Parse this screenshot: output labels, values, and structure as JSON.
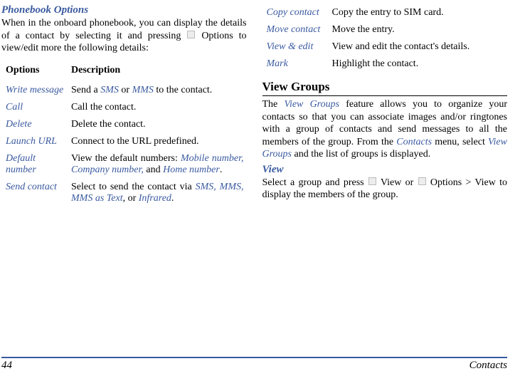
{
  "left": {
    "heading": "Phonebook Options",
    "intro_a": "When in the onboard phonebook, you can display the details of a contact by selecting it and pressing ",
    "intro_b": " Options to view/edit more the following details:",
    "th_options": "Options",
    "th_desc": "Description",
    "rows": [
      {
        "opt": "Write message",
        "desc_a": "Send a ",
        "link1": "SMS",
        "mid": " or ",
        "link2": "MMS",
        "desc_b": " to the contact."
      },
      {
        "opt": "Call",
        "desc": "Call the contact."
      },
      {
        "opt": "Delete",
        "desc": "Delete the contact."
      },
      {
        "opt": "Launch URL",
        "desc": "Connect to the URL predefined."
      },
      {
        "opt": "Default number",
        "desc_a": "View the default numbers: ",
        "link1": "Mobile number, Company number,",
        "mid": " and ",
        "link2": "Home number",
        "desc_b": "."
      },
      {
        "opt": "Send contact",
        "desc_a": "Select to send the contact via ",
        "link1": "SMS, MMS, MMS as Text",
        "mid": ", or ",
        "link2": "Infrared",
        "desc_b": "."
      }
    ]
  },
  "right": {
    "rows": [
      {
        "opt": "Copy contact",
        "desc": "Copy the entry to SIM card."
      },
      {
        "opt": "Move contact",
        "desc": "Move the entry."
      },
      {
        "opt": "View & edit",
        "desc": "View and edit the contact's details."
      },
      {
        "opt": "Mark",
        "desc": "Highlight the contact."
      }
    ],
    "h2": "View Groups",
    "para_a": "The ",
    "para_link1": "View Groups",
    "para_b": " feature allows you to organize your contacts so that you can associate images and/or ringtones with a group of contacts and send messages to all the members of the group. From the ",
    "para_link2": "Contacts",
    "para_c": " menu, select ",
    "para_link3": "View Groups",
    "para_d": " and the list of groups is displayed.",
    "sub_heading": "View",
    "view_a": "Select a group and press ",
    "view_mid": " View or ",
    "view_b": " Options > View to display the members of the group."
  },
  "footer": {
    "page": "44",
    "section": "Contacts"
  }
}
